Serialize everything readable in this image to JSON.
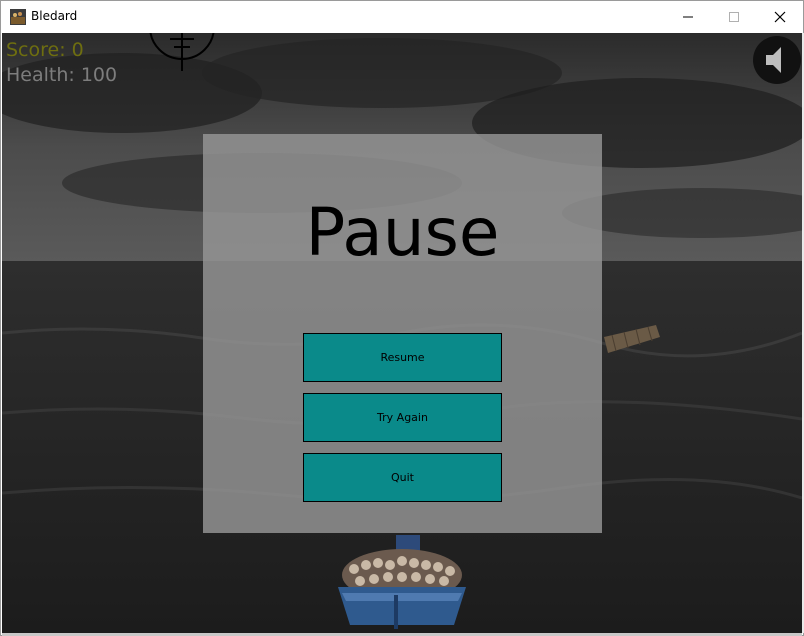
{
  "window": {
    "title": "Bledard",
    "controls": [
      "minimize",
      "maximize",
      "close"
    ]
  },
  "hud": {
    "score": "Score: 0",
    "health": "Health: 100",
    "score_color": "#6e6e10",
    "health_color": "#7d7d7d"
  },
  "pause_menu": {
    "title": "Pause",
    "buttons": [
      {
        "label": "Resume"
      },
      {
        "label": "Try Again"
      },
      {
        "label": "Quit"
      }
    ],
    "button_color": "#0a8a8a"
  },
  "icons": {
    "crosshair": "crosshair-icon",
    "sound": "speaker-icon"
  }
}
